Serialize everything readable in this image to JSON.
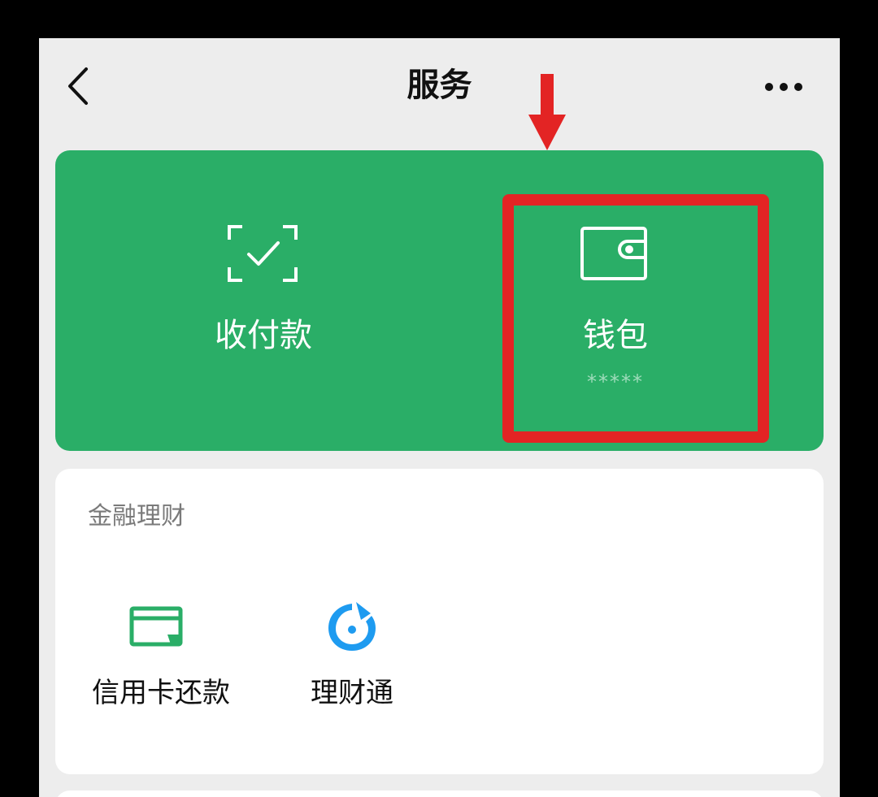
{
  "navbar": {
    "title": "服务",
    "back_icon": "chevron-left-icon",
    "more_icon": "more-dots-icon"
  },
  "top_services": {
    "background_color": "#2aae67",
    "items": [
      {
        "label": "收付款",
        "icon": "scan-check-icon"
      },
      {
        "label": "钱包",
        "icon": "wallet-icon",
        "sub": "*****"
      }
    ]
  },
  "annotation": {
    "box_color": "#e32424",
    "arrow_color": "#e32424"
  },
  "finance": {
    "title": "金融理财",
    "items": [
      {
        "label": "信用卡还款",
        "icon": "credit-card-icon",
        "icon_color": "#2aae67"
      },
      {
        "label": "理财通",
        "icon": "licaitong-icon",
        "icon_color": "#1e9bf0"
      }
    ]
  }
}
